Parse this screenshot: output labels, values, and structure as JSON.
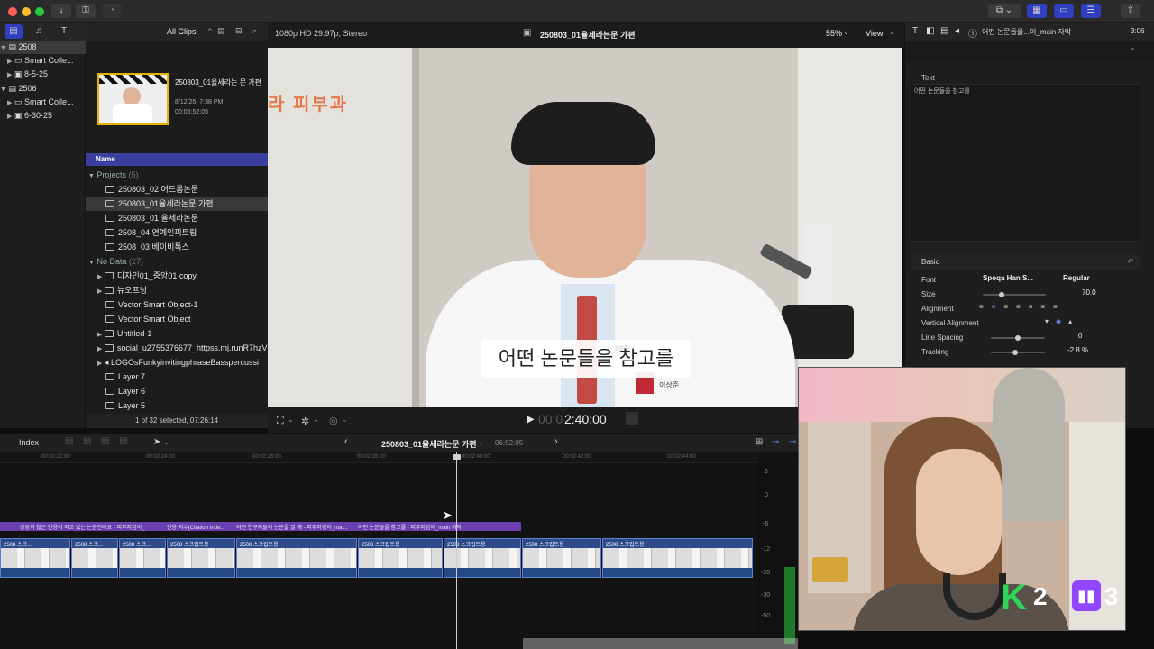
{
  "toolbar": {
    "all_clips": "All Clips",
    "format": "1080p HD 29.97p, Stereo",
    "project_title": "250803_01율세라는문 가편",
    "zoom": "55%",
    "view": "View",
    "inspector_title": "어떤 논문들을...이_main 자막",
    "inspector_duration": "3:06"
  },
  "library": {
    "items": [
      {
        "label": "2508",
        "level": 0
      },
      {
        "label": "Smart Colle...",
        "level": 1
      },
      {
        "label": "8-5-25",
        "level": 1
      },
      {
        "label": "2506",
        "level": 0
      },
      {
        "label": "Smart Colle...",
        "level": 1
      },
      {
        "label": "6-30-25",
        "level": 1
      }
    ]
  },
  "browser": {
    "clip_name": "250803_01율세라는 문 가편",
    "clip_date": "8/12/25, 7:38 PM",
    "clip_duration": "00:06:52:05",
    "name_header": "Name",
    "projects_label": "Projects",
    "projects_count": "(5)",
    "projects": [
      "250803_02 어드롬논문",
      "250803_01율세라논문 가편",
      "250803_01 율세라논문",
      "2508_04 연예인피트림",
      "2508_03 베이비톡스"
    ],
    "nodata_label": "No Data",
    "nodata_count": "(27)",
    "nodata_items": [
      "디자인01_중앙01 copy",
      "뉴오프닝",
      "Vector Smart Object-1",
      "Vector Smart Object",
      "Untitled-1",
      "social_u2755376677_httpss.mj.runR7hzV",
      "LOGOsFunkyinvitingphraseBasspercussi",
      "Layer 7",
      "Layer 6",
      "Layer 5"
    ],
    "status": "1 of 32 selected, 07:26:14"
  },
  "viewer": {
    "wall_sign": "라 피부과",
    "subtitle": "어떤 논문들을 참고를",
    "timecode": "2:40:00",
    "timecode_prefix": "00:0",
    "badge_text": "이상준"
  },
  "inspector": {
    "text_label": "Text",
    "text_value": "어떤 논문들을 참고를",
    "basic_label": "Basic",
    "font_label": "Font",
    "font_value": "Spoqa Han S...",
    "font_weight": "Regular",
    "size_label": "Size",
    "size_value": "70.0",
    "size_level": 0.3,
    "alignment_label": "Alignment",
    "valign_label": "Vertical Alignment",
    "line_spacing_label": "Line Spacing",
    "line_spacing_value": "0",
    "line_spacing_level": 0.5,
    "tracking_label": "Tracking",
    "tracking_value": "-2.8 %",
    "tracking_level": 0.45
  },
  "timeline": {
    "index_label": "Index",
    "project_name": "250803_01율세라는문 가편",
    "project_duration": "06:52:05",
    "ruler": [
      "00:02:22:00",
      "00:02:24:00",
      "00:02:26:00",
      "00:02:28:00",
      "00:02:40:00",
      "00:02:42:00",
      "00:02:44:00"
    ],
    "title_clips": [
      "상당히 많은 인용이 되고 있는 논문인데요 - 피부지킴이_",
      "인용 지수(Citation Inde...",
      "어떤 연구자들의 논문을 잘 해 - 피부지킴이_mai...",
      "어떤 논문들을 참고를 - 피부지킴이_main 자막"
    ],
    "video_clip_label": "2508 스크립트용",
    "video_clip_short": "2508 스크...",
    "meter_labels": [
      "6",
      "0",
      "-6",
      "-12",
      "-20",
      "-30",
      "-50"
    ]
  },
  "overlay": {
    "k_count": "2",
    "twitch_count": "3"
  },
  "colors": {
    "accent": "#3b3fa0",
    "title_clip": "#6a3fb0",
    "video_clip": "#2d4a8a",
    "selection": "#e6b400",
    "k_green": "#2dd65a",
    "twitch_purple": "#9146ff"
  }
}
